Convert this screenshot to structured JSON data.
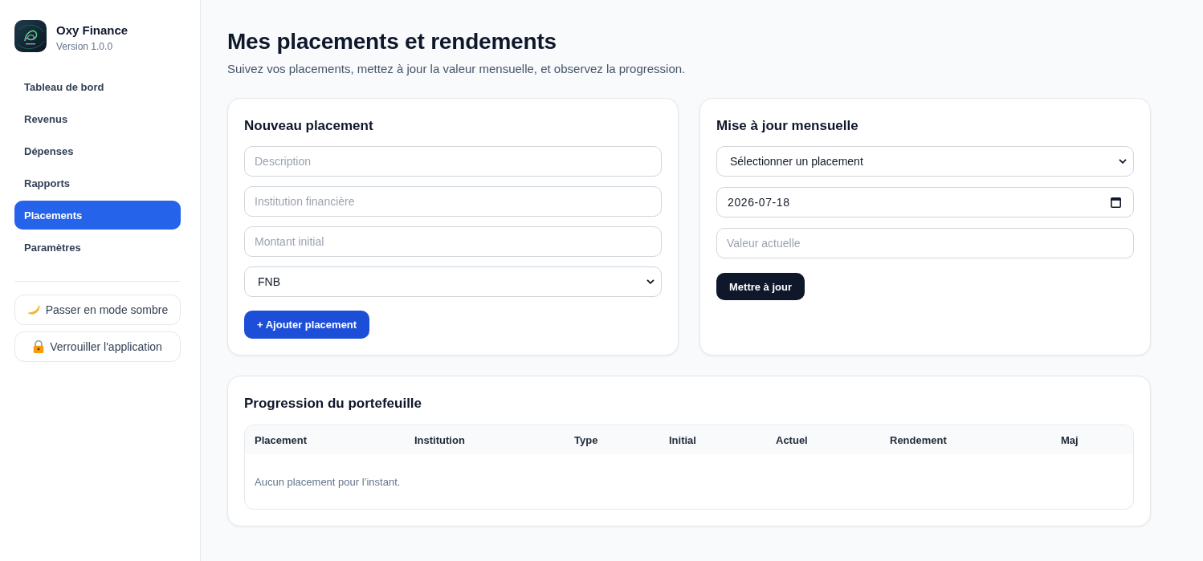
{
  "sidebar": {
    "app_name": "Oxy Finance",
    "version": "Version 1.0.0",
    "nav": [
      {
        "label": "Tableau de bord",
        "selected": false
      },
      {
        "label": "Revenus",
        "selected": false
      },
      {
        "label": "Dépenses",
        "selected": false
      },
      {
        "label": "Rapports",
        "selected": false
      },
      {
        "label": "Placements",
        "selected": true
      },
      {
        "label": "Paramètres",
        "selected": false
      }
    ],
    "actions": [
      {
        "kind": "theme",
        "label": "Passer en mode sombre"
      },
      {
        "kind": "lock",
        "label": "Verrouiller l'application"
      }
    ]
  },
  "header": {
    "title": "Mes placements et rendements",
    "subtitle": "Suivez vos placements, mettez à jour la valeur mensuelle, et observez la progression."
  },
  "new_placement": {
    "title": "Nouveau placement",
    "fields": [
      {
        "kind": "text",
        "placeholder": "Description"
      },
      {
        "kind": "text",
        "placeholder": "Institution financière"
      },
      {
        "kind": "text",
        "placeholder": "Montant initial"
      },
      {
        "kind": "select",
        "value": "FNB"
      }
    ],
    "button": "+ Ajouter placement"
  },
  "monthly_update": {
    "title": "Mise à jour mensuelle",
    "fields": [
      {
        "kind": "select",
        "value": "Sélectionner un placement"
      },
      {
        "kind": "date",
        "value": "2026-07-18"
      },
      {
        "kind": "text",
        "placeholder": "Valeur actuelle"
      }
    ],
    "button": "Mettre à jour"
  },
  "portfolio": {
    "title": "Progression du portefeuille",
    "table": {
      "columns": [
        "Placement",
        "Institution",
        "Type",
        "Initial",
        "Actuel",
        "Rendement",
        "Maj"
      ],
      "empty_message": "Aucun placement pour l’instant."
    }
  }
}
